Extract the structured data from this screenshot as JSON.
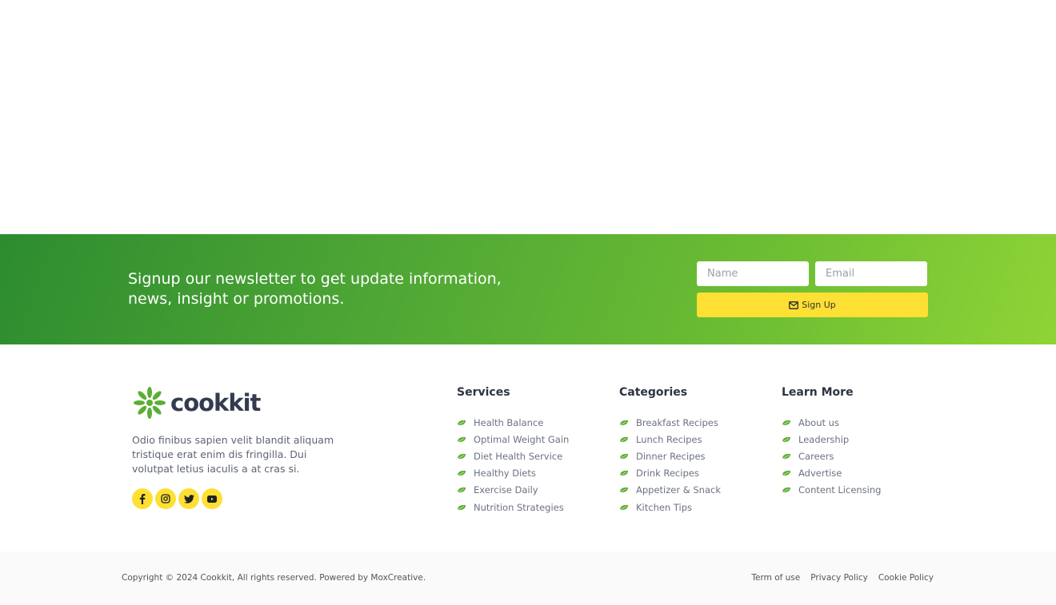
{
  "newsletter": {
    "text": "Signup our newsletter to get update information, news, insight or promotions.",
    "name_placeholder": "Name",
    "email_placeholder": "Email",
    "button_label": "Sign Up",
    "button_icon": "envelope-icon"
  },
  "brand": {
    "logo_text": "cookkit",
    "description": "Odio finibus sapien velit blandit aliquam tristique erat enim dis fringilla. Dui volutpat letius iaculis a at cras si.",
    "socials": [
      "facebook-icon",
      "instagram-icon",
      "twitter-icon",
      "youtube-icon"
    ]
  },
  "columns": [
    {
      "title": "Services",
      "items": [
        "Health Balance",
        "Optimal Weight Gain",
        "Diet Health Service",
        "Healthy Diets",
        "Exercise Daily",
        "Nutrition Strategies"
      ]
    },
    {
      "title": "Categories",
      "items": [
        "Breakfast Recipes",
        "Lunch Recipes",
        "Dinner Recipes",
        "Drink Recipes",
        "Appetizer & Snack",
        "Kitchen Tips"
      ]
    },
    {
      "title": "Learn More",
      "items": [
        "About us",
        "Leadership",
        "Careers",
        "Advertise",
        "Content Licensing"
      ]
    }
  ],
  "bottom": {
    "copyright": "Copyright © 2024 Cookkit, All rights reserved. Powered by MoxCreative.",
    "links": [
      "Term of use",
      "Privacy Policy",
      "Cookie Policy"
    ]
  },
  "colors": {
    "accent_green": "#4da534",
    "accent_yellow": "#fde033",
    "leaf": "#5aae32"
  }
}
